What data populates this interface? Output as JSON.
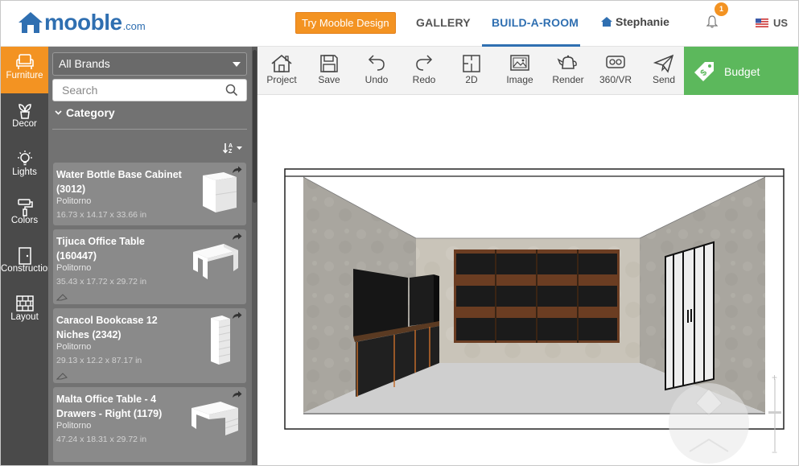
{
  "header": {
    "logo_word": "mooble",
    "logo_suffix": ".com",
    "cta_label": "Try Mooble Design",
    "nav": {
      "gallery": "GALLERY",
      "build": "BUILD-A-ROOM"
    },
    "user_name": "Stephanie",
    "notification_count": "1",
    "locale": "US"
  },
  "rail": {
    "items": [
      {
        "label": "Furniture",
        "icon": "armchair-icon"
      },
      {
        "label": "Decor",
        "icon": "plant-icon"
      },
      {
        "label": "Lights",
        "icon": "bulb-icon"
      },
      {
        "label": "Colors",
        "icon": "paint-roller-icon"
      },
      {
        "label": "Construction",
        "icon": "door-icon"
      },
      {
        "label": "Layout",
        "icon": "brick-wall-icon"
      }
    ]
  },
  "panel": {
    "brand_value": "All Brands",
    "search_placeholder": "Search",
    "category_label": "Category",
    "products": [
      {
        "name": "Water Bottle Base Cabinet (3012)",
        "brand": "Politorno",
        "dims": "16.73 x 14.17 x 33.66 in"
      },
      {
        "name": "Tijuca Office Table (160447)",
        "brand": "Politorno",
        "dims": "35.43 x 17.72 x 29.72 in"
      },
      {
        "name": "Caracol Bookcase 12 Niches (2342)",
        "brand": "Politorno",
        "dims": "29.13 x 12.2 x 87.17 in"
      },
      {
        "name": "Malta Office Table - 4 Drawers - Right (1179)",
        "brand": "Politorno",
        "dims": "47.24 x 18.31 x 29.72 in"
      }
    ]
  },
  "toolbar": {
    "tools": [
      {
        "label": "Project",
        "icon": "house-icon"
      },
      {
        "label": "Save",
        "icon": "floppy-icon"
      },
      {
        "label": "Undo",
        "icon": "undo-icon"
      },
      {
        "label": "Redo",
        "icon": "redo-icon"
      },
      {
        "label": "2D",
        "icon": "floorplan-icon"
      },
      {
        "label": "Image",
        "icon": "image-icon"
      },
      {
        "label": "Render",
        "icon": "teapot-icon"
      },
      {
        "label": "360/VR",
        "icon": "vr-headset-icon"
      },
      {
        "label": "Send",
        "icon": "paper-plane-icon"
      }
    ],
    "budget_label": "Budget"
  },
  "colors": {
    "brand_blue": "#2f6fb1",
    "accent_orange": "#f39322",
    "budget_green": "#5cb85c"
  }
}
